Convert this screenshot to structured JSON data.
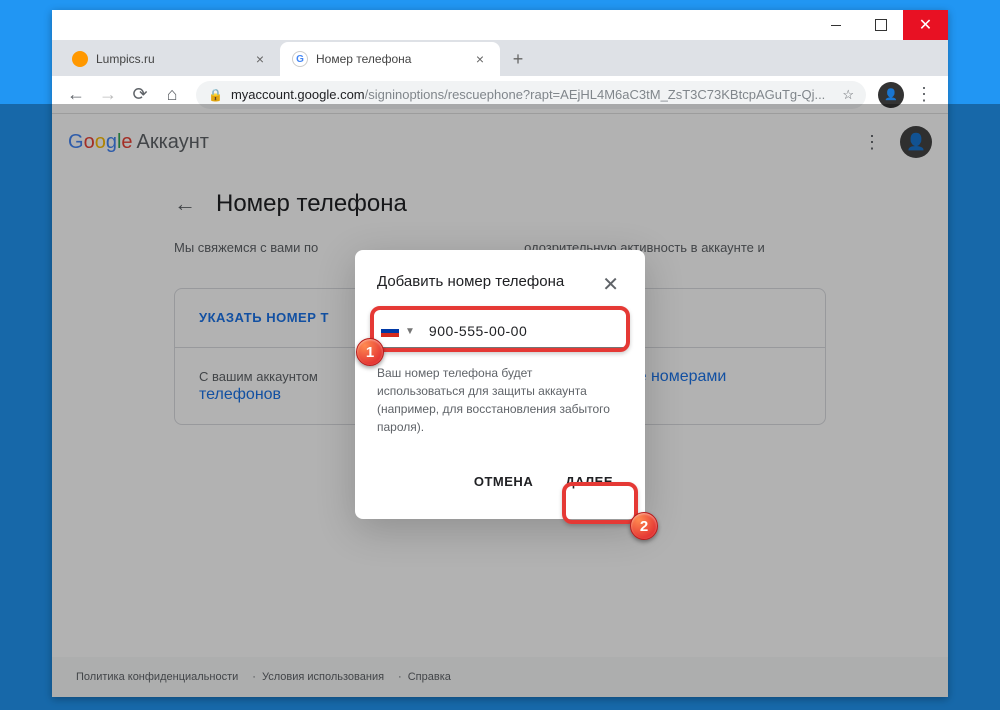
{
  "browser": {
    "tabs": [
      {
        "title": "Lumpics.ru"
      },
      {
        "title": "Номер телефона"
      }
    ],
    "url_domain": "myaccount.google.com",
    "url_path": "/signinoptions/rescuephone?rapt=AEjHL4M6aC3tM_ZsT3C73KBtcpAGuTg-Qj..."
  },
  "header": {
    "logo_g": "G",
    "logo_o1": "o",
    "logo_o2": "o",
    "logo_g2": "g",
    "logo_l": "l",
    "logo_e": "e",
    "product": "Аккаунт"
  },
  "page": {
    "title": "Номер телефона",
    "description_1": "Мы свяжемся с вами по",
    "description_2": "одозрительную активность в аккаунте и",
    "card_action": "УКАЗАТЬ НОМЕР Т",
    "card_text_1": "С вашим аккаунтом",
    "card_link": "вление номерами телефонов"
  },
  "modal": {
    "title": "Добавить номер телефона",
    "phone_value": "900-555-00-00",
    "description": "Ваш номер телефона будет использоваться для защиты аккаунта (например, для восстановления забытого пароля).",
    "cancel": "ОТМЕНА",
    "next": "ДАЛЕЕ"
  },
  "footer": {
    "privacy": "Политика конфиденциальности",
    "terms": "Условия использования",
    "help": "Справка"
  },
  "annotations": {
    "badge1": "1",
    "badge2": "2"
  }
}
